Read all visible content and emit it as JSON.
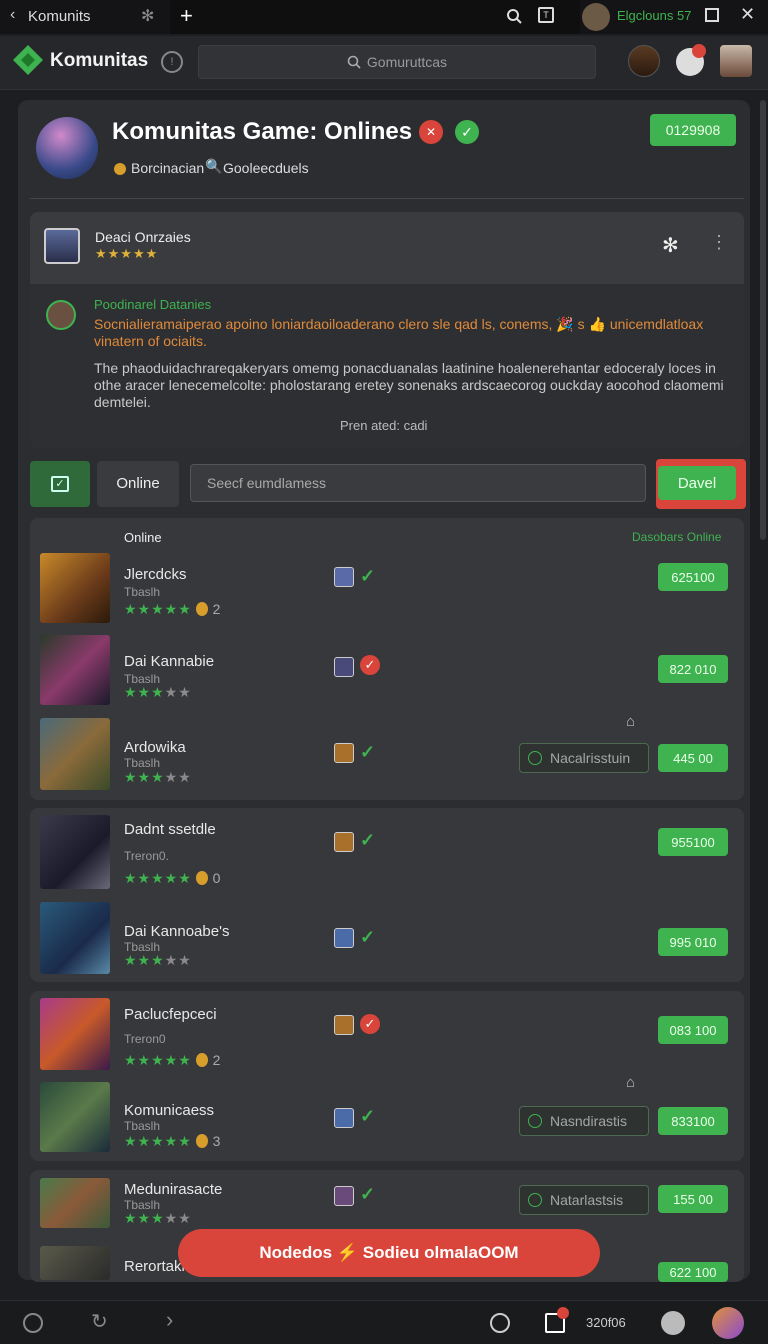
{
  "tabbar": {
    "tab_title": "Komunits",
    "user_label": "Elgclouns 57"
  },
  "appbar": {
    "brand": "Komunitas",
    "search_placeholder": "Gomuruttcas"
  },
  "header": {
    "title": "Komunitas Game: Onlines",
    "meta_1": "Borcinacian",
    "meta_2": "Gooleecduels",
    "action_btn": "0129908"
  },
  "post": {
    "author": "Deaci Onrzaies",
    "section_label": "Poodinarel Datanies",
    "highlight": "Socnialieramaiperao apoino loniardaoiloaderano clero sle qad ls, conems, 🎉 s 👍 unicemdlatloax vinatern of ociaits.",
    "body": "The phaoduidachrareqakeryars omemg ponacduanalas laatinine hoalenerehantar edoceraly loces in othe aracer lenecemelcolte: pholostarang eretey sonenaks ardscaecorog ouckday aocohod claomemi demtelei.",
    "footer": "Pren ated: cadi"
  },
  "filters": {
    "tab_online": "Online",
    "search_placeholder": "Seecf eumdlamess",
    "action": "Davel"
  },
  "list_header": {
    "left": "Online",
    "right": "Dasobars Online"
  },
  "groups": [
    {
      "items": [
        {
          "name": "Jlercdcks",
          "sub": "Tbaslh",
          "stars": 5,
          "extra": "2",
          "price": "625100",
          "check": "green"
        },
        {
          "name": "Dai Kannabie",
          "sub": "Tbaslh",
          "stars": 3,
          "extra": "",
          "price": "822 010",
          "check": "red"
        },
        {
          "name": "Ardowika",
          "sub": "Tbaslh",
          "stars": 3,
          "extra": "",
          "price": "445 00",
          "check": "green",
          "outline_btn": "Nacalrisstuin"
        }
      ]
    },
    {
      "items": [
        {
          "name": "Dadnt ssetdle",
          "sub": "Treron0.",
          "stars": 5,
          "extra": "0",
          "price": "955100",
          "check": "green"
        },
        {
          "name": "Dai Kannoabe's",
          "sub": "Tbaslh",
          "stars": 3,
          "extra": "",
          "price": "995 010",
          "check": "green"
        }
      ]
    },
    {
      "items": [
        {
          "name": "Paclucfepceci",
          "sub": "Treron0",
          "stars": 5,
          "extra": "2",
          "price": "083 100",
          "check": "red"
        },
        {
          "name": "Komunicaess",
          "sub": "Tbaslh",
          "stars": 5,
          "extra": "3",
          "price": "833100",
          "check": "green",
          "outline_btn": "Nasndirastis"
        }
      ]
    },
    {
      "items": [
        {
          "name": "Medunirasacte",
          "sub": "Tbaslh",
          "stars": 3,
          "extra": "",
          "price": "155 00",
          "check": "green",
          "outline_btn": "Natarlastsis"
        },
        {
          "name": "Rerortaki",
          "sub": "",
          "stars": 0,
          "extra": "",
          "price": "622 100",
          "check": "green"
        }
      ]
    }
  ],
  "toast": {
    "text": "Nodedos ⚡ Sodieu olmalaOOM"
  },
  "bottombar": {
    "counter": "320f06"
  },
  "colors": {
    "accent": "#3eb34f",
    "danger": "#d9453b",
    "bg": "#1d1e21"
  }
}
